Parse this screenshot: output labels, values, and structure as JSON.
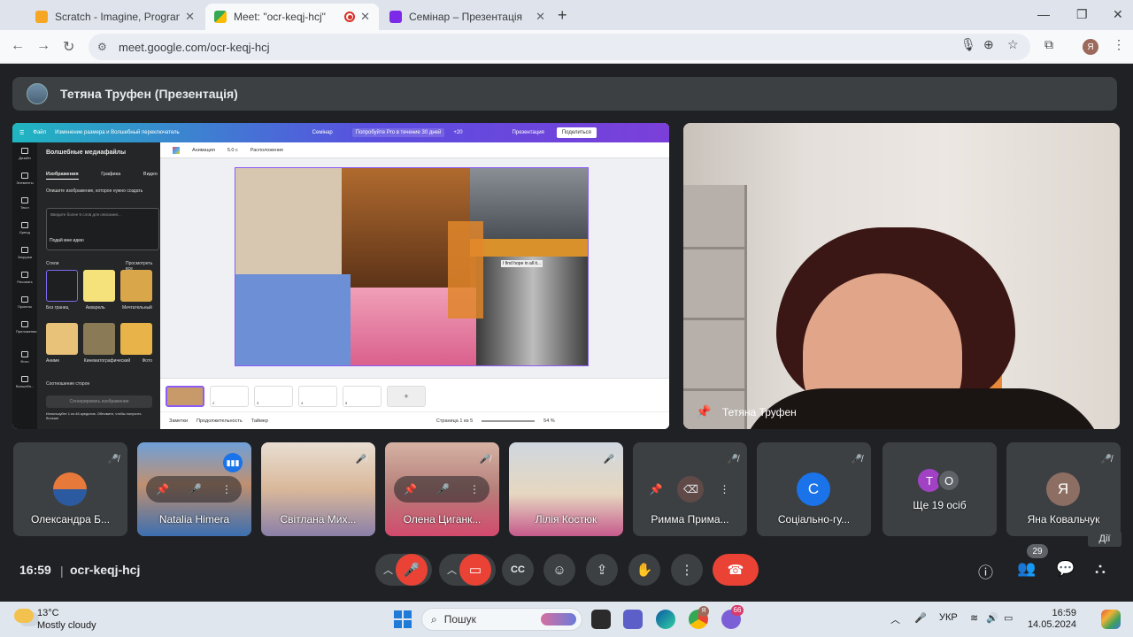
{
  "browser": {
    "tabs": [
      {
        "title": "Scratch - Imagine, Program, Sh",
        "close": "✕"
      },
      {
        "title": "Meet: \"ocr-keqj-hcj\"",
        "close": "✕"
      },
      {
        "title": "Семінар – Презентація",
        "close": "✕"
      }
    ],
    "new_tab": "+",
    "url": "meet.google.com/ocr-keqj-hcj",
    "profile_initial": "Я"
  },
  "presenter_bar": {
    "title": "Тетяна Труфен (Презентація)"
  },
  "shared_screen": {
    "top_menu": [
      "Файл",
      "Изменение размера и Волшебный переключатель",
      "Семінар",
      "Попробуйте Pro в течение 30 дней",
      "+20",
      "Презентация",
      "Поделиться"
    ],
    "left_rail": [
      "Дизайн",
      "Элементы",
      "Текст",
      "Бренд",
      "Загрузки",
      "Рисовать",
      "Проекты",
      "Приложения",
      "Фото",
      "Волшебн..."
    ],
    "panel_title": "Волшебные медиафайлы",
    "panel_tabs": [
      "Изображения",
      "Графика",
      "Видео"
    ],
    "describe_label": "Опишите изображение, которое нужно создать",
    "describe_placeholder": "Введите более 5 слов для описания...",
    "magic_prompt": "Подай мне идею",
    "styles_label": "Стили",
    "view_all": "Просмотреть все",
    "styles": [
      "Без границ",
      "Акварель",
      "Мечтательный",
      "Аниме",
      "Кинематографический",
      "Фото"
    ],
    "aspect_label": "Соотношение сторон",
    "generate": "Сгенерировать изображение",
    "credits_note": "Используйте 1 из 46 кредитов. Обновите, чтобы получить больше",
    "toolbar": [
      "Анимация",
      "5.0 с",
      "Расположение"
    ],
    "page_numbers": [
      "2",
      "3",
      "4",
      "5"
    ],
    "add_page": "+",
    "footer": {
      "notes": "Заметки",
      "duration": "Продолжительность",
      "timer": "Таймер",
      "page": "Страница 1 из 5",
      "zoom": "54 %"
    },
    "collage_quote": "I find hope in all it..."
  },
  "main_speaker": {
    "name": "Тетяна Труфен"
  },
  "participants": [
    {
      "name": "Олександра Б...",
      "muted": true
    },
    {
      "name": "Natalia Himera",
      "muted": false,
      "speaking": true
    },
    {
      "name": "Світлана Мих...",
      "muted": true
    },
    {
      "name": "Олена Циганк...",
      "muted": true
    },
    {
      "name": "Лілія Костюк",
      "muted": true
    },
    {
      "name": "Римма Прима...",
      "muted": true
    },
    {
      "name": "Соціально-гу...",
      "muted": true,
      "initial": "С"
    },
    {
      "name": "Ще 19 осіб",
      "initials": [
        "Т",
        "О"
      ]
    },
    {
      "name": "Яна Ковальчук",
      "muted": true,
      "initial": "Я"
    }
  ],
  "controls": {
    "time": "16:59",
    "separator": "|",
    "meeting_code": "ocr-keqj-hcj",
    "people_count": "29",
    "actions_tooltip": "Дії"
  },
  "taskbar": {
    "temp": "13°C",
    "weather": "Mostly cloudy",
    "search": "Пошук",
    "lang": "УКР",
    "time": "16:59",
    "date": "14.05.2024",
    "chrome_badge": "Я",
    "app_badge": "66"
  },
  "colors": {
    "meet_bg": "#202124",
    "tile_bg": "#3c4043",
    "end_call": "#ea4335",
    "speaking": "#1a73e8",
    "canva_gradient": "#5a4ee0"
  }
}
